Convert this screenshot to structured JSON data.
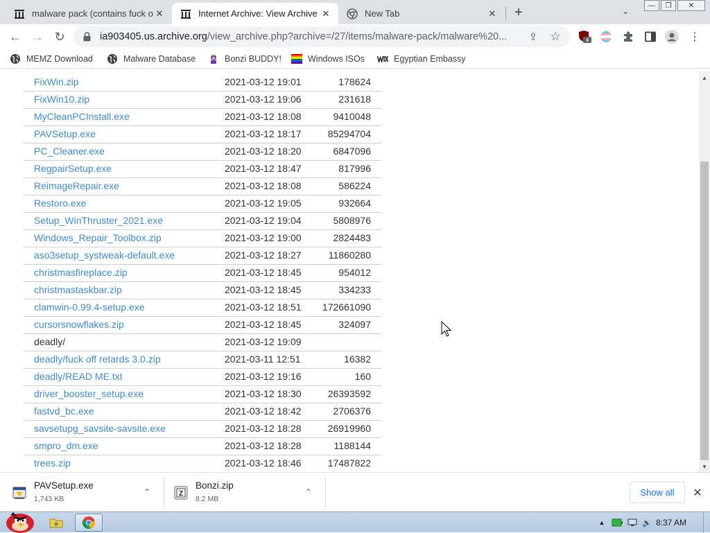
{
  "window": {
    "minimize_glyph": "—",
    "restore_glyph": "❐",
    "close_glyph": "✕"
  },
  "tabs": [
    {
      "title": "malware pack (contains fuck o",
      "icon": "archive-icon",
      "active": false
    },
    {
      "title": "Internet Archive: View Archive",
      "icon": "archive-icon",
      "active": true
    },
    {
      "title": "New Tab",
      "icon": "chrome-icon",
      "active": false
    }
  ],
  "newtab_glyph": "+",
  "tab_search_glyph": "⌄",
  "toolbar": {
    "back_glyph": "←",
    "forward_glyph": "→",
    "reload_glyph": "↻",
    "url_host": "ia903405.us.archive.org",
    "url_path": "/view_archive.php?archive=/27/items/malware-pack/malware%20...",
    "share_glyph": "⇪",
    "bookmark_star_glyph": "☆",
    "extension_badge": "4",
    "menu_glyph": "⋮"
  },
  "bookmarks": [
    {
      "label": "MEMZ Download",
      "icon": "globe-icon"
    },
    {
      "label": "Malware Database",
      "icon": "globe-icon"
    },
    {
      "label": "Bonzi BUDDY!",
      "icon": "bonzi-icon"
    },
    {
      "label": "Windows ISOs",
      "icon": "rainbow-flag-icon"
    },
    {
      "label": "Egyptian Embassy",
      "icon": "wix-icon"
    }
  ],
  "files": [
    {
      "name": "FixWin.zip",
      "date": "2021-03-12 19:01",
      "size": "178624",
      "link": true
    },
    {
      "name": "FixWin10.zip",
      "date": "2021-03-12 19:06",
      "size": "231618",
      "link": true
    },
    {
      "name": "MyCleanPCInstall.exe",
      "date": "2021-03-12 18:08",
      "size": "9410048",
      "link": true
    },
    {
      "name": "PAVSetup.exe",
      "date": "2021-03-12 18:17",
      "size": "85294704",
      "link": true
    },
    {
      "name": "PC_Cleaner.exe",
      "date": "2021-03-12 18:20",
      "size": "6847096",
      "link": true
    },
    {
      "name": "RegpairSetup.exe",
      "date": "2021-03-12 18:47",
      "size": "817996",
      "link": true
    },
    {
      "name": "ReimageRepair.exe",
      "date": "2021-03-12 18:08",
      "size": "586224",
      "link": true
    },
    {
      "name": "Restoro.exe",
      "date": "2021-03-12 19:05",
      "size": "932664",
      "link": true
    },
    {
      "name": "Setup_WinThruster_2021.exe",
      "date": "2021-03-12 19:04",
      "size": "5808976",
      "link": true
    },
    {
      "name": "Windows_Repair_Toolbox.zip",
      "date": "2021-03-12 19:00",
      "size": "2824483",
      "link": true
    },
    {
      "name": "aso3setup_systweak-default.exe",
      "date": "2021-03-12 18:27",
      "size": "11860280",
      "link": true
    },
    {
      "name": "christmasfireplace.zip",
      "date": "2021-03-12 18:45",
      "size": "954012",
      "link": true
    },
    {
      "name": "christmastaskbar.zip",
      "date": "2021-03-12 18:45",
      "size": "334233",
      "link": true
    },
    {
      "name": "clamwin-0.99.4-setup.exe",
      "date": "2021-03-12 18:51",
      "size": "172661090",
      "link": true
    },
    {
      "name": "cursorsnowflakes.zip",
      "date": "2021-03-12 18:45",
      "size": "324097",
      "link": true
    },
    {
      "name": "deadly/",
      "date": "2021-03-12 19:09",
      "size": "",
      "link": false
    },
    {
      "name": "deadly/fuck off retards 3.0.zip",
      "date": "2021-03-11 12:51",
      "size": "16382",
      "link": true
    },
    {
      "name": "deadly/READ ME.txt",
      "date": "2021-03-12 19:16",
      "size": "160",
      "link": true
    },
    {
      "name": "driver_booster_setup.exe",
      "date": "2021-03-12 18:30",
      "size": "26393592",
      "link": true
    },
    {
      "name": "fastvd_bc.exe",
      "date": "2021-03-12 18:42",
      "size": "2706376",
      "link": true
    },
    {
      "name": "savsetupg_savsite-savsite.exe",
      "date": "2021-03-12 18:28",
      "size": "26919960",
      "link": true
    },
    {
      "name": "smpro_dm.exe",
      "date": "2021-03-12 18:28",
      "size": "1188144",
      "link": true
    },
    {
      "name": "trees.zip",
      "date": "2021-03-12 18:46",
      "size": "17487822",
      "link": true
    }
  ],
  "downloads": [
    {
      "name": "PAVSetup.exe",
      "size": "1,743 KB",
      "icon": "installer-icon"
    },
    {
      "name": "Bonzi.zip",
      "size": "8.2 MB",
      "icon": "zip-icon"
    }
  ],
  "downloads_chevron_glyph": "⌃",
  "show_all_label": "Show all",
  "downloads_close_glyph": "✕",
  "taskbar": {
    "clock": "8:37 AM",
    "tray_up_glyph": "▲",
    "volume_glyph": "🔊"
  },
  "colors": {
    "link": "#428bca",
    "tabbar": "#dee1e6",
    "taskbar": "#b9cde4"
  }
}
